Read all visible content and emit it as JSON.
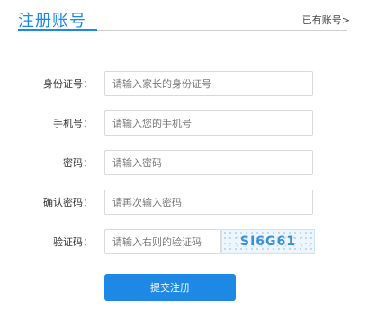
{
  "header": {
    "title": "注册账号",
    "login_link": "已有账号>"
  },
  "form": {
    "fields": [
      {
        "label": "身份证号：",
        "placeholder": "请输入家长的身份证号"
      },
      {
        "label": "手机号：",
        "placeholder": "请输入您的手机号"
      },
      {
        "label": "密码：",
        "placeholder": "请输入密码"
      },
      {
        "label": "确认密码：",
        "placeholder": "请再次输入密码"
      },
      {
        "label": "验证码：",
        "placeholder": "请输入右则的验证码"
      }
    ],
    "captcha_text": "SI6G61",
    "submit_label": "提交注册"
  },
  "colors": {
    "accent": "#1e88e5"
  }
}
